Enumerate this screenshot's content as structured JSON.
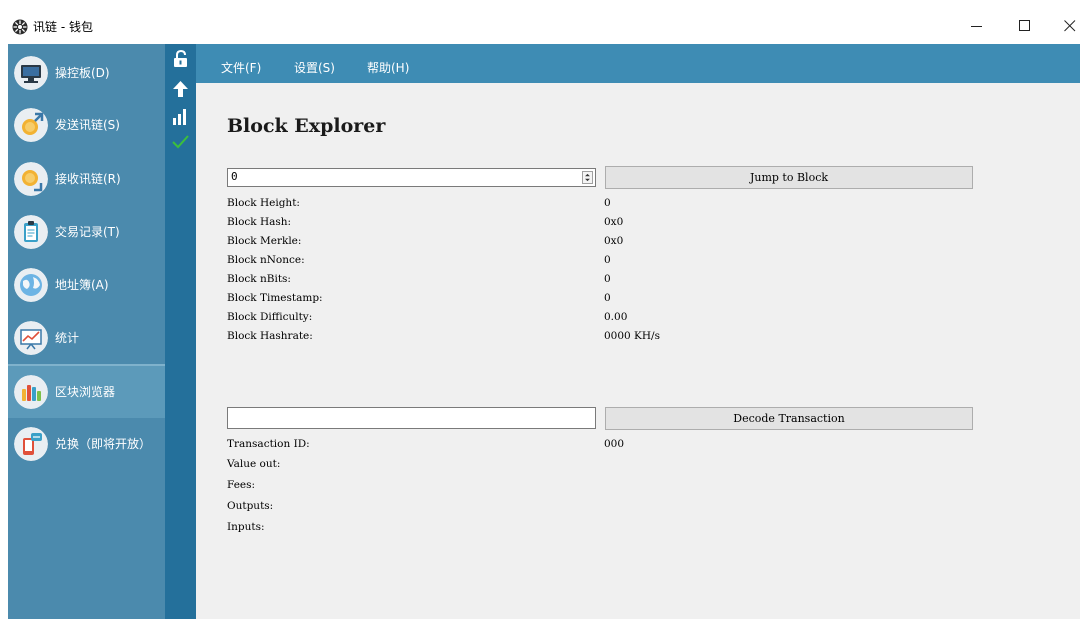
{
  "window": {
    "title": "讯链 - 钱包"
  },
  "sidebar": {
    "items": [
      {
        "label": "操控板(D)",
        "icon": "monitor-icon"
      },
      {
        "label": "发送讯链(S)",
        "icon": "send-coin-icon"
      },
      {
        "label": "接收讯链(R)",
        "icon": "receive-coin-icon"
      },
      {
        "label": "交易记录(T)",
        "icon": "clipboard-icon"
      },
      {
        "label": "地址簿(A)",
        "icon": "globe-icon"
      },
      {
        "label": "统计",
        "icon": "chart-board-icon"
      },
      {
        "label": "区块浏览器",
        "icon": "block-bars-icon"
      },
      {
        "label": "兑换（即将开放）",
        "icon": "exchange-phone-icon"
      }
    ],
    "active_index": 6
  },
  "menu": {
    "file": "文件(F)",
    "settings": "设置(S)",
    "help": "帮助(H)"
  },
  "explorer": {
    "title": "Block Explorer",
    "block_input_value": "0",
    "jump_button": "Jump to Block",
    "fields": [
      {
        "label": "Block Height:",
        "value": "0"
      },
      {
        "label": "Block Hash:",
        "value": "0x0"
      },
      {
        "label": "Block Merkle:",
        "value": "0x0"
      },
      {
        "label": "Block nNonce:",
        "value": "0"
      },
      {
        "label": "Block nBits:",
        "value": "0"
      },
      {
        "label": "Block Timestamp:",
        "value": "0"
      },
      {
        "label": "Block Difficulty:",
        "value": "0.00"
      },
      {
        "label": "Block Hashrate:",
        "value": "0000 KH/s"
      }
    ],
    "tx_input_value": "",
    "decode_button": "Decode Transaction",
    "tx_fields": [
      {
        "label": "Transaction ID:",
        "value": "000"
      },
      {
        "label": "Value out:",
        "value": ""
      },
      {
        "label": "Fees:",
        "value": ""
      },
      {
        "label": "Outputs:",
        "value": ""
      },
      {
        "label": "Inputs:",
        "value": ""
      }
    ]
  },
  "colors": {
    "sidebar": "#4b8aad",
    "status_strip": "#24709b",
    "menubar": "#3e8cb4",
    "content_bg": "#f0f0f0",
    "check_green": "#3cbf3c"
  }
}
